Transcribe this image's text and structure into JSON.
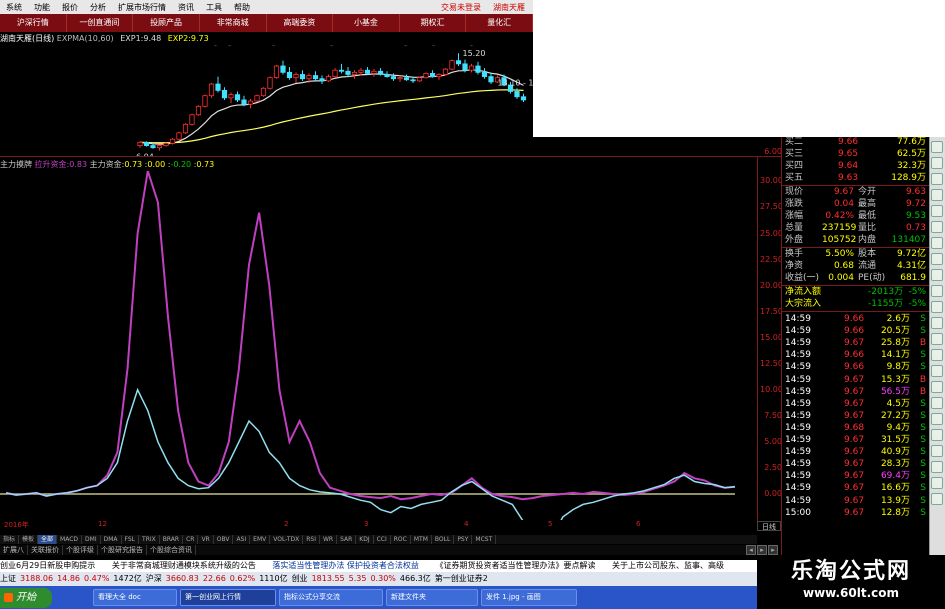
{
  "menu": {
    "items": [
      "系统",
      "功能",
      "报价",
      "分析",
      "扩展市场行情",
      "资讯",
      "工具",
      "帮助"
    ],
    "login": "交易未登录",
    "account": "湖南天雁"
  },
  "nav": {
    "tabs": [
      "沪深行情",
      "一创直通间",
      "投顾产品",
      "非常商城",
      "高端委资",
      "小基金",
      "期权汇",
      "量化汇"
    ]
  },
  "kline": {
    "stock": "湖南天雁(日线)",
    "indicator": "EXPMA(10,60)",
    "exp1_label": "EXP1:",
    "exp1": "9.48",
    "exp2_label": "EXP2:",
    "exp2": "9.73",
    "high_mark": "15.20",
    "right_mark": "13.10 - 1",
    "low_mark": "6.04",
    "yaxis_label": "6.00",
    "candles": [
      [
        6.5,
        6.9,
        6.3,
        6.8
      ],
      [
        6.8,
        6.9,
        6.4,
        6.5
      ],
      [
        6.5,
        6.7,
        6.2,
        6.3
      ],
      [
        6.3,
        6.6,
        6.04,
        6.5
      ],
      [
        6.5,
        6.8,
        6.4,
        6.7
      ],
      [
        6.7,
        7.2,
        6.6,
        7.1
      ],
      [
        7.1,
        7.8,
        7.0,
        7.7
      ],
      [
        7.7,
        8.6,
        7.6,
        8.5
      ],
      [
        8.5,
        9.5,
        8.4,
        9.4
      ],
      [
        9.4,
        10.3,
        9.3,
        10.2
      ],
      [
        10.2,
        11.3,
        10.1,
        11.2
      ],
      [
        11.2,
        12.4,
        11.0,
        12.3
      ],
      [
        12.3,
        13.0,
        11.5,
        11.7
      ],
      [
        11.7,
        12.0,
        10.8,
        11.0
      ],
      [
        11.0,
        11.5,
        10.5,
        11.3
      ],
      [
        11.3,
        11.6,
        10.6,
        10.8
      ],
      [
        10.8,
        11.2,
        10.2,
        10.4
      ],
      [
        10.4,
        10.9,
        10.0,
        10.7
      ],
      [
        10.7,
        11.3,
        10.6,
        11.2
      ],
      [
        11.2,
        12.0,
        11.1,
        11.9
      ],
      [
        11.9,
        13.0,
        11.8,
        12.9
      ],
      [
        12.9,
        14.1,
        12.8,
        14.0
      ],
      [
        14.0,
        14.5,
        13.2,
        13.4
      ],
      [
        13.4,
        13.9,
        12.7,
        12.9
      ],
      [
        12.9,
        13.4,
        12.4,
        13.2
      ],
      [
        13.2,
        13.6,
        12.6,
        12.8
      ],
      [
        12.8,
        13.3,
        12.4,
        13.1
      ],
      [
        13.1,
        13.5,
        12.6,
        12.8
      ],
      [
        12.8,
        13.1,
        12.3,
        12.6
      ],
      [
        12.6,
        13.2,
        12.5,
        13.0
      ],
      [
        13.0,
        13.8,
        12.9,
        13.6
      ],
      [
        13.6,
        14.2,
        13.3,
        13.5
      ],
      [
        13.5,
        13.9,
        13.0,
        13.2
      ],
      [
        13.2,
        13.6,
        12.8,
        13.4
      ],
      [
        13.4,
        13.8,
        13.1,
        13.6
      ],
      [
        13.6,
        13.9,
        13.2,
        13.3
      ],
      [
        13.3,
        13.7,
        13.0,
        13.5
      ],
      [
        13.5,
        13.8,
        13.1,
        13.2
      ],
      [
        13.2,
        13.5,
        12.9,
        13.0
      ],
      [
        13.0,
        13.3,
        12.6,
        12.8
      ],
      [
        12.8,
        13.1,
        12.5,
        12.9
      ],
      [
        12.9,
        13.2,
        12.6,
        12.7
      ],
      [
        12.7,
        13.0,
        12.4,
        12.6
      ],
      [
        12.6,
        13.0,
        12.5,
        12.9
      ],
      [
        12.9,
        13.4,
        12.8,
        13.3
      ],
      [
        13.3,
        13.6,
        12.9,
        13.0
      ],
      [
        13.0,
        13.3,
        12.7,
        13.2
      ],
      [
        13.2,
        13.8,
        13.1,
        13.7
      ],
      [
        13.7,
        14.6,
        13.6,
        14.5
      ],
      [
        14.5,
        15.2,
        14.0,
        14.2
      ],
      [
        14.2,
        14.6,
        13.4,
        13.6
      ],
      [
        13.6,
        14.2,
        13.4,
        14.0
      ],
      [
        14.0,
        14.4,
        13.2,
        13.4
      ],
      [
        13.4,
        13.8,
        12.8,
        13.0
      ],
      [
        13.0,
        13.4,
        12.3,
        12.5
      ],
      [
        12.5,
        13.1,
        12.4,
        12.9
      ],
      [
        12.9,
        13.2,
        12.1,
        12.2
      ],
      [
        12.2,
        12.5,
        11.4,
        11.6
      ],
      [
        11.6,
        11.9,
        10.9,
        11.1
      ],
      [
        11.1,
        11.4,
        10.6,
        10.8
      ]
    ]
  },
  "indicator": {
    "name": "主力摸牌",
    "s1_label": "拉升资金:",
    "s1": "0.83",
    "s2_label": "主力资金:",
    "s2": "0.73",
    "v3": "0.00",
    "v4": "-0.20",
    "v5": "0.73",
    "yaxis": [
      "30.00",
      "27.50",
      "25.00",
      "22.50",
      "20.00",
      "17.50",
      "15.00",
      "12.50",
      "10.00",
      "7.50",
      "5.00",
      "2.50",
      "0.00"
    ],
    "chart_data": {
      "type": "line",
      "ylim": [
        -2.5,
        31
      ],
      "series": [
        {
          "name": "拉升资金",
          "color": "#c040c0",
          "values": [
            0.1,
            -0.1,
            0,
            0.1,
            -0.2,
            0,
            0.1,
            0.3,
            0.6,
            0.8,
            1.8,
            4,
            12,
            25,
            31,
            28,
            17,
            8,
            3,
            1.2,
            0.8,
            2,
            5,
            12,
            22,
            27,
            20,
            10,
            5,
            7,
            5,
            2,
            0.6,
            0.3,
            0,
            -0.2,
            -0.3,
            -0.4,
            -0.2,
            -0.5,
            -0.4,
            -0.2,
            0,
            -0.1,
            0.1,
            0.8,
            1.5,
            0.6,
            0,
            -0.2,
            -0.3,
            -0.5,
            -0.4,
            -0.2,
            -0.1,
            0,
            0.1,
            0,
            0.2,
            0.1,
            0,
            -0.1,
            0,
            0.2,
            0.5,
            0.8,
            1.2,
            2,
            1.5,
            1.3,
            0.8,
            0.6,
            0.7
          ]
        },
        {
          "name": "主力资金",
          "color": "#90e0f0",
          "values": [
            0.1,
            -0.1,
            0,
            0.1,
            -0.2,
            0,
            0.1,
            0.3,
            0.6,
            0.8,
            1.5,
            3,
            7,
            10,
            8,
            5,
            3,
            1.5,
            0.8,
            0.5,
            0.6,
            1.5,
            3,
            5,
            7,
            6,
            4,
            3,
            1.5,
            0.8,
            0.4,
            0.2,
            0.1,
            0,
            -0.3,
            -0.6,
            -0.8,
            -1.5,
            -1.8,
            -1.2,
            -1.4,
            -1.0,
            -0.8,
            -0.6,
            0.2,
            0.8,
            1.2,
            0.5,
            -0.2,
            -0.6,
            -1,
            -2.5,
            -4.5,
            -6.5,
            -4,
            -2.2,
            -1.5,
            -1.0,
            -0.8,
            -0.5,
            -0.2,
            0,
            0.1,
            0.3,
            0.6,
            0.9,
            1.5,
            1.8,
            1.2,
            1.0,
            0.9,
            0.6,
            0.7
          ]
        }
      ]
    }
  },
  "xaxis": {
    "labels": [
      "2016年",
      "12",
      "2",
      "3",
      "4",
      "5",
      "6"
    ],
    "day_button": "日线"
  },
  "indicator_tabs": [
    "指标",
    "模板",
    "全部",
    "MACD",
    "DMI",
    "DMA",
    "FSL",
    "TRIX",
    "BRAR",
    "CR",
    "VR",
    "OBV",
    "ASI",
    "EMV",
    "VOL-TDX",
    "RSI",
    "WR",
    "SAR",
    "KDJ",
    "CCI",
    "ROC",
    "MTM",
    "BOLL",
    "PSY",
    "MCST"
  ],
  "bottom_tabs": [
    "扩展八",
    "关联报价",
    "个股评级",
    "个股研究报告",
    "个股综合资讯"
  ],
  "news": [
    "创业6月29日新股申购提示",
    "关于非常商城理财通模块系统升级的公告",
    "落实适当性管理办法 保护投资者合法权益",
    "《证券期货投资者适当性管理办法》要点解读",
    "关于上市公司股东、监事、高级"
  ],
  "quote": [
    {
      "n": "上证",
      "v": "3188.06",
      "c": "14.86",
      "p": "0.47%",
      "a": "1472亿"
    },
    {
      "n": "沪深",
      "v": "3660.83",
      "c": "22.66",
      "p": "0.62%",
      "a": "1110亿"
    },
    {
      "n": "创业",
      "v": "1813.55",
      "c": "5.35",
      "p": "0.30%",
      "a": "466.3亿"
    }
  ],
  "quote_tail": "第一创业证券2",
  "taskbar": {
    "start": "开始",
    "tasks": [
      "看理大全 doc",
      "第一创业网上行情",
      "指标公式分享交流",
      "新建文件夹",
      "发件 1.jpg - 画图"
    ]
  },
  "brand": {
    "title": "乐淘公式网",
    "url": "www.60lt.com"
  },
  "side": {
    "book": [
      {
        "l": "买二",
        "p": "9.66",
        "v": "77.6万"
      },
      {
        "l": "买三",
        "p": "9.65",
        "v": "62.5万"
      },
      {
        "l": "买四",
        "p": "9.64",
        "v": "32.3万"
      },
      {
        "l": "买五",
        "p": "9.63",
        "v": "128.9万"
      }
    ],
    "stats": [
      {
        "l1": "现价",
        "v1": "9.67",
        "l2": "今开",
        "v2": "9.63"
      },
      {
        "l1": "涨跌",
        "v1": "0.04",
        "l2": "最高",
        "v2": "9.72"
      },
      {
        "l1": "涨幅",
        "v1": "0.42%",
        "l2": "最低",
        "v2": "9.53"
      },
      {
        "l1": "总量",
        "v1": "237159",
        "l2": "量比",
        "v2": "0.73"
      },
      {
        "l1": "外盘",
        "v1": "105752",
        "l2": "内盘",
        "v2": "131407"
      }
    ],
    "stats2": [
      {
        "l1": "换手",
        "v1": "5.50%",
        "l2": "股本",
        "v2": "9.72亿"
      },
      {
        "l1": "净资",
        "v1": "0.68",
        "l2": "流通",
        "v2": "4.31亿"
      },
      {
        "l1": "收益(一)",
        "v1": "0.004",
        "l2": "PE(动)",
        "v2": "681.9"
      }
    ],
    "flow": [
      {
        "l": "净流入额",
        "v": "-2013万",
        "p": "-5%"
      },
      {
        "l": "大宗流入",
        "v": "-1155万",
        "p": "-5%"
      }
    ],
    "ticks": [
      {
        "t": "14:59",
        "p": "9.66",
        "v": "2.6万",
        "s": "S"
      },
      {
        "t": "14:59",
        "p": "9.66",
        "v": "20.5万",
        "s": "S"
      },
      {
        "t": "14:59",
        "p": "9.67",
        "v": "25.8万",
        "s": "B"
      },
      {
        "t": "14:59",
        "p": "9.66",
        "v": "14.1万",
        "s": "S"
      },
      {
        "t": "14:59",
        "p": "9.66",
        "v": "9.8万",
        "s": "S"
      },
      {
        "t": "14:59",
        "p": "9.67",
        "v": "15.3万",
        "s": "B"
      },
      {
        "t": "14:59",
        "p": "9.67",
        "v": "56.5万",
        "s": "B"
      },
      {
        "t": "14:59",
        "p": "9.67",
        "v": "4.5万",
        "s": "S"
      },
      {
        "t": "14:59",
        "p": "9.67",
        "v": "27.2万",
        "s": "S"
      },
      {
        "t": "14:59",
        "p": "9.68",
        "v": "9.4万",
        "s": "S"
      },
      {
        "t": "14:59",
        "p": "9.67",
        "v": "31.5万",
        "s": "S"
      },
      {
        "t": "14:59",
        "p": "9.67",
        "v": "40.9万",
        "s": "S"
      },
      {
        "t": "14:59",
        "p": "9.67",
        "v": "28.3万",
        "s": "S"
      },
      {
        "t": "14:59",
        "p": "9.67",
        "v": "69.4万",
        "s": "S"
      },
      {
        "t": "14:59",
        "p": "9.67",
        "v": "16.6万",
        "s": "S"
      },
      {
        "t": "14:59",
        "p": "9.67",
        "v": "13.9万",
        "s": "S"
      },
      {
        "t": "15:00",
        "p": "9.67",
        "v": "12.8万",
        "s": "S"
      }
    ]
  }
}
